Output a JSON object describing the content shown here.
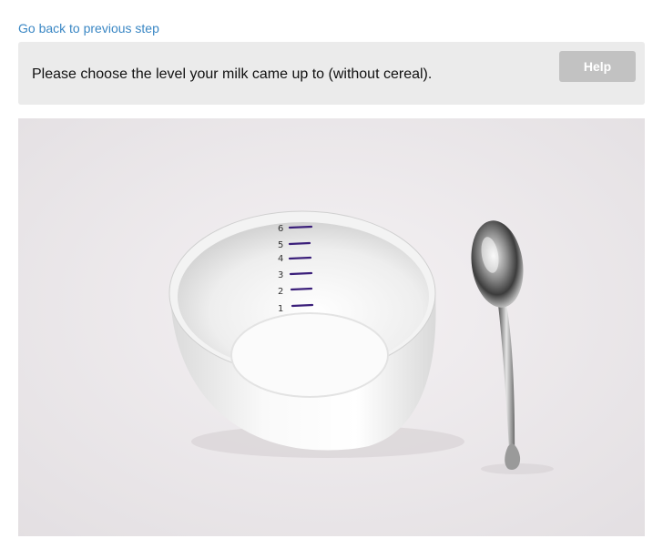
{
  "nav": {
    "back_link": "Go back to previous step"
  },
  "question": {
    "prompt": "Please choose the level your milk came up to (without cereal).",
    "help_label": "Help"
  },
  "photo": {
    "subject": "bowl-with-level-markings-and-spoon",
    "level_marks": [
      "6",
      "5",
      "4",
      "3",
      "2",
      "1"
    ],
    "colors": {
      "background": "#ebe7ea",
      "bowl": "#f7f7f7",
      "marking": "#3b1f7a"
    }
  },
  "colors": {
    "link": "#3a87c4",
    "prompt_panel": "#ebebeb",
    "help_button": "#c2c2c2"
  }
}
